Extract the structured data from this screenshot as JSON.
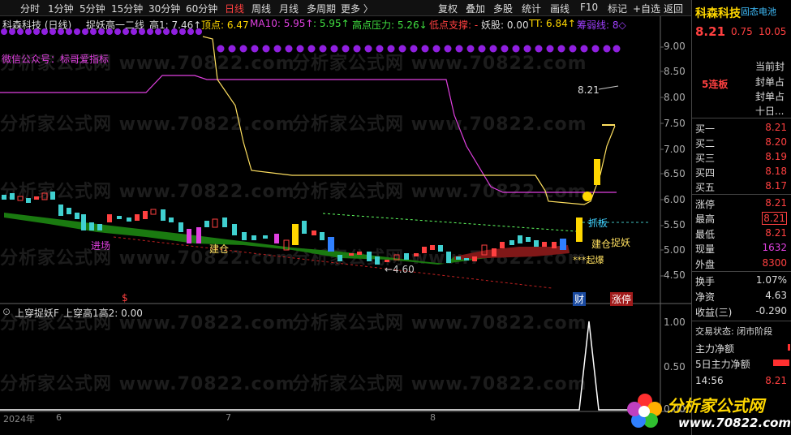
{
  "toolbar": {
    "left_items": [
      "分时",
      "1分钟",
      "5分钟",
      "15分钟",
      "30分钟",
      "60分钟",
      "日线",
      "周线",
      "月线",
      "多周期",
      "更多 〉"
    ],
    "active": "日线",
    "right_items": [
      "复权",
      "叠加",
      "多股",
      "统计",
      "画线",
      "F10",
      "标记",
      "+自选",
      "返回"
    ]
  },
  "info": {
    "stock": "科森科技 (日线)",
    "indicator": "捉妖高一二线",
    "high1": "高1: 7.46↑",
    "top": "顶点: 6.47",
    "ma10": "MA10: 5.95↑",
    "dot": ": 5.95↑",
    "resist": "高点压力: 5.26↓",
    "support": "低点支撑: -",
    "yao": "妖股: 0.00",
    "tt": "TT: 6.84↑",
    "weak": "筹弱线: 8◇"
  },
  "chart_texts": {
    "wechat": "微信公众号：标哥爱指标",
    "price_label": "8.21",
    "zhuaban": "抓板",
    "jinchang": "进场",
    "jiancang": "建仓",
    "jiancang2": "建仓",
    "zhuoyao": "捉妖",
    "qibao": "***起爆",
    "low_label": "←4.60",
    "dollar": "$",
    "cai": "财",
    "zhangting": "涨停"
  },
  "price_axis": [
    "9.00",
    "8.50",
    "8.00",
    "7.50",
    "7.00",
    "6.50",
    "6.00",
    "5.50",
    "5.00",
    "4.50"
  ],
  "sub_axis": [
    "1.00",
    "0.50",
    "0.00"
  ],
  "sub_info": {
    "name": "上穿捉妖F",
    "value": "上穿高1高2: 0.00"
  },
  "dates": [
    "2024年",
    "6",
    "7",
    "8"
  ],
  "watermark": "分析家公式网 www.70822.com",
  "right": {
    "name": "科森科技",
    "concept": "固态电池",
    "price": "8.21",
    "change": "0.75",
    "pct": "10.05",
    "board": "5连板",
    "notes": [
      "当前封",
      "封单占",
      "封单占",
      "十日..."
    ],
    "book": [
      {
        "label": "买一",
        "val": "8.21"
      },
      {
        "label": "买二",
        "val": "8.20"
      },
      {
        "label": "买三",
        "val": "8.19"
      },
      {
        "label": "买四",
        "val": "8.18"
      },
      {
        "label": "买五",
        "val": "8.17"
      }
    ],
    "stats": [
      {
        "label": "涨停",
        "val": "8.21"
      },
      {
        "label": "最高",
        "val": "8.21"
      },
      {
        "label": "最低",
        "val": "8.21"
      },
      {
        "label": "现量",
        "val": "1632"
      },
      {
        "label": "外盘",
        "val": "8300"
      },
      {
        "label": "换手",
        "val": "1.07%"
      },
      {
        "label": "净资",
        "val": "4.63"
      },
      {
        "label": "收益(三)",
        "val": "-0.290"
      }
    ],
    "trade_status": "交易状态: 闭市阶段",
    "main_net": "主力净额",
    "main_net5": "5日主力净额",
    "time": "14:56",
    "time_price": "8.21"
  },
  "logo": {
    "title": "分析家公式网",
    "url": "www.70822.com"
  }
}
